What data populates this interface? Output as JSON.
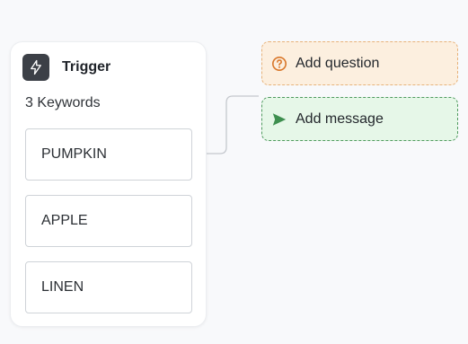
{
  "trigger": {
    "title": "Trigger",
    "icon": "lightning-icon",
    "keywords_label": "3 Keywords",
    "keywords": [
      "PUMPKIN",
      "APPLE",
      "LINEN"
    ]
  },
  "actions": [
    {
      "label": "Add question",
      "icon": "question-circle-icon",
      "accent": "#d9772a",
      "background": "#fcefdf"
    },
    {
      "label": "Add message",
      "icon": "send-icon",
      "accent": "#3e8f4f",
      "background": "#e6f7e8"
    }
  ]
}
